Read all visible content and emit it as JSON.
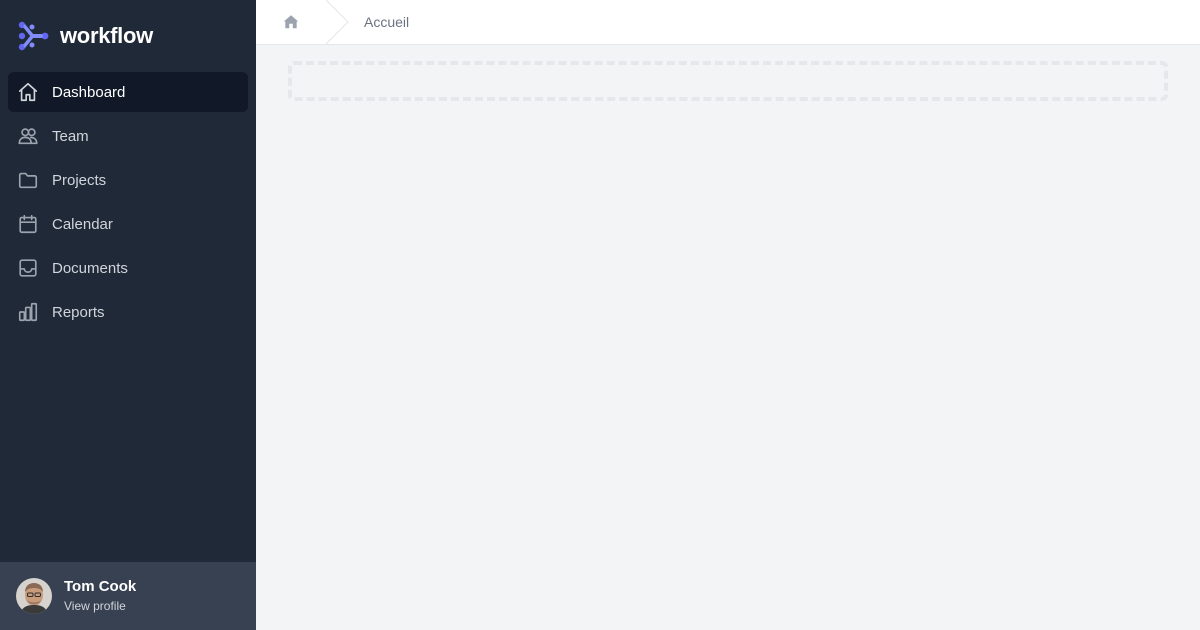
{
  "brand": {
    "name": "workflow",
    "logo_icon": "workflow-logo-icon",
    "accent_color": "#6366f1"
  },
  "sidebar": {
    "items": [
      {
        "label": "Dashboard",
        "icon": "home-icon",
        "active": true
      },
      {
        "label": "Team",
        "icon": "users-icon",
        "active": false
      },
      {
        "label": "Projects",
        "icon": "folder-icon",
        "active": false
      },
      {
        "label": "Calendar",
        "icon": "calendar-icon",
        "active": false
      },
      {
        "label": "Documents",
        "icon": "inbox-icon",
        "active": false
      },
      {
        "label": "Reports",
        "icon": "chart-bar-icon",
        "active": false
      }
    ]
  },
  "profile": {
    "name": "Tom Cook",
    "link_label": "View profile"
  },
  "breadcrumb": {
    "home_icon": "home-solid-icon",
    "current": "Accueil"
  },
  "colors": {
    "sidebar_bg": "#1f2937",
    "sidebar_active_bg": "#111827",
    "profile_bg": "#374151",
    "page_bg": "#f3f4f6",
    "placeholder_border": "#e5e7eb"
  }
}
